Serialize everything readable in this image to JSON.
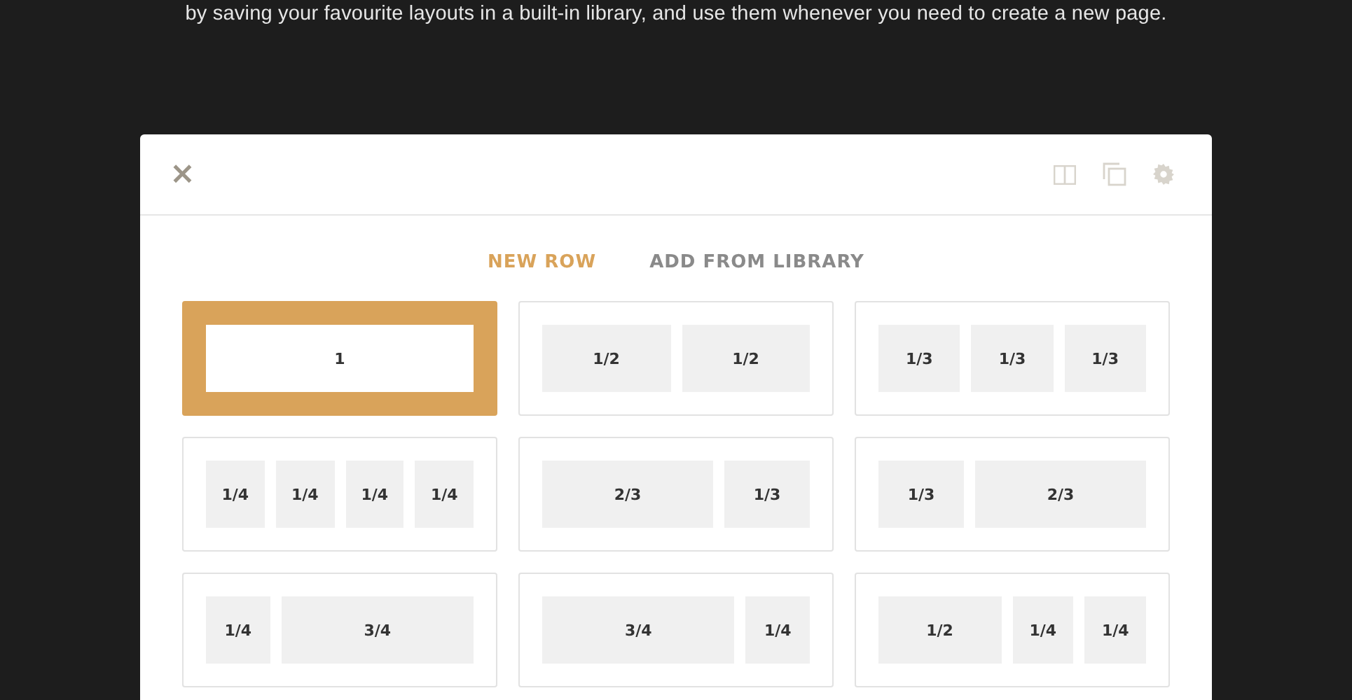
{
  "intro": "by saving your favourite layouts in a built-in library, and use them whenever you need to create a new page.",
  "modal": {
    "close": "×",
    "tabs": [
      {
        "label": "NEW ROW",
        "selected": true
      },
      {
        "label": "ADD FROM LIBRARY",
        "selected": false
      }
    ],
    "layouts": [
      {
        "selected": true,
        "cells": [
          {
            "kind": "full",
            "label": "1"
          }
        ]
      },
      {
        "selected": false,
        "cells": [
          {
            "kind": "half",
            "label": "1/2"
          },
          {
            "kind": "half",
            "label": "1/2"
          }
        ]
      },
      {
        "selected": false,
        "cells": [
          {
            "kind": "third",
            "label": "1/3"
          },
          {
            "kind": "third",
            "label": "1/3"
          },
          {
            "kind": "third",
            "label": "1/3"
          }
        ]
      },
      {
        "selected": false,
        "cells": [
          {
            "kind": "quarter",
            "label": "1/4"
          },
          {
            "kind": "quarter",
            "label": "1/4"
          },
          {
            "kind": "quarter",
            "label": "1/4"
          },
          {
            "kind": "quarter",
            "label": "1/4"
          }
        ]
      },
      {
        "selected": false,
        "cells": [
          {
            "kind": "two-thirds",
            "label": "2/3"
          },
          {
            "kind": "third",
            "label": "1/3"
          }
        ]
      },
      {
        "selected": false,
        "cells": [
          {
            "kind": "third",
            "label": "1/3"
          },
          {
            "kind": "two-thirds",
            "label": "2/3"
          }
        ]
      },
      {
        "selected": false,
        "cells": [
          {
            "kind": "quarter",
            "label": "1/4"
          },
          {
            "kind": "three-quarters",
            "label": "3/4"
          }
        ]
      },
      {
        "selected": false,
        "cells": [
          {
            "kind": "three-quarters",
            "label": "3/4"
          },
          {
            "kind": "quarter",
            "label": "1/4"
          }
        ]
      },
      {
        "selected": false,
        "cells": [
          {
            "kind": "half",
            "label": "1/2"
          },
          {
            "kind": "quarter",
            "label": "1/4"
          },
          {
            "kind": "quarter",
            "label": "1/4"
          }
        ]
      }
    ]
  }
}
